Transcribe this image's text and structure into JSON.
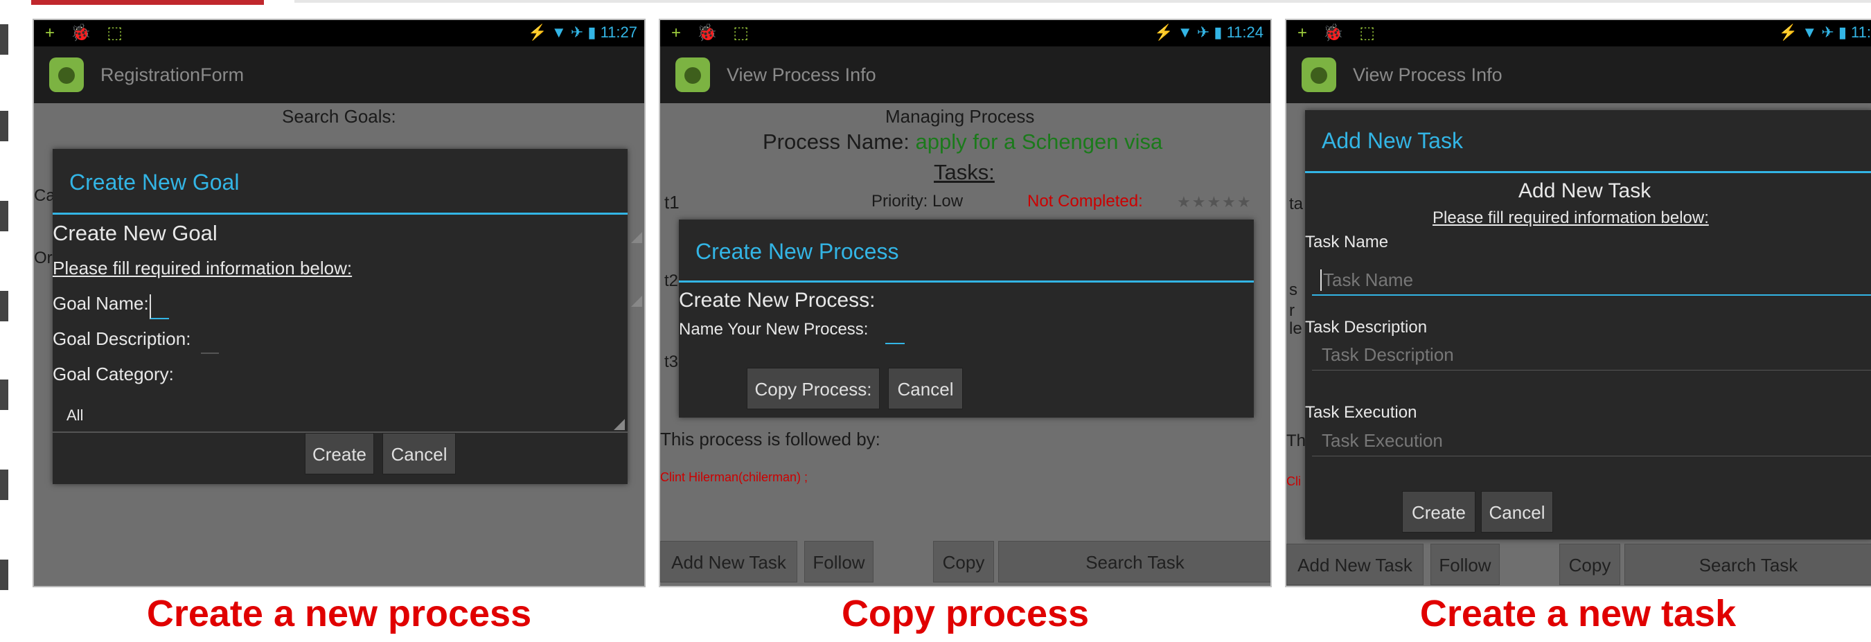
{
  "screens": {
    "s1": {
      "status_time": "11:27",
      "app_title": "RegistrationForm",
      "bg_search": "Search Goals:",
      "bg_partial_ca": "Ca",
      "bg_partial_or": "Or",
      "dialog": {
        "title": "Create New Goal",
        "heading": "Create New Goal",
        "instruction": "Please fill required information below:",
        "goal_name_label": "Goal Name:",
        "goal_desc_label": "Goal Description:",
        "goal_category_label": "Goal Category:",
        "category_value": "All",
        "create_label": "Create",
        "cancel_label": "Cancel"
      }
    },
    "s2": {
      "status_time": "11:24",
      "app_title": "View Process Info",
      "managing": "Managing Process",
      "process_name_label": "Process Name:",
      "process_name_value": "apply for a Schengen visa",
      "tasks_label": "Tasks:",
      "task_t1": "t1",
      "priority": "Priority: Low",
      "not_completed": "Not Completed:",
      "stars": "★★★★★",
      "partial_t2": "t2",
      "partial_t3": "t3",
      "followed_by": "This process is followed by:",
      "follower": "Clint Hilerman(chilerman) ;",
      "dialog": {
        "title": "Create New Process",
        "heading": "Create New Process:",
        "name_label": "Name Your New Process:",
        "copy_label": "Copy Process:",
        "cancel_label": "Cancel"
      },
      "bottom": {
        "add_task": "Add New Task",
        "follow": "Follow",
        "copy": "Copy",
        "search_task": "Search Task"
      }
    },
    "s3": {
      "status_time": "11:",
      "app_title": "View Process Info",
      "partial_ta": "ta",
      "partial_s": "s",
      "partial_r": "r",
      "partial_le": "le",
      "partial_th": "Th",
      "partial_cli": "Cli",
      "dialog": {
        "title": "Add New Task",
        "heading": "Add New Task",
        "instruction": "Please fill required information below:",
        "task_name_label": "Task Name",
        "task_name_hint": "Task Name",
        "task_desc_label": "Task Description",
        "task_desc_hint": "Task Description",
        "task_exec_label": "Task Execution",
        "task_exec_hint": "Task Execution",
        "create_label": "Create",
        "cancel_label": "Cancel"
      },
      "bottom": {
        "add_task": "Add New Task",
        "follow": "Follow",
        "copy": "Copy",
        "search_task": "Search Task"
      }
    }
  },
  "captions": {
    "c1": "Create a new process",
    "c2": "Copy process",
    "c3": "Create a new task"
  },
  "colors": {
    "caption": "#e00000",
    "holo_blue": "#33b5e5",
    "accent_bar": "#c0272d"
  },
  "icons": {
    "status_left": "+ 🐞 ⬚",
    "status_right": "⚡ ▼ ✈ ▮"
  }
}
